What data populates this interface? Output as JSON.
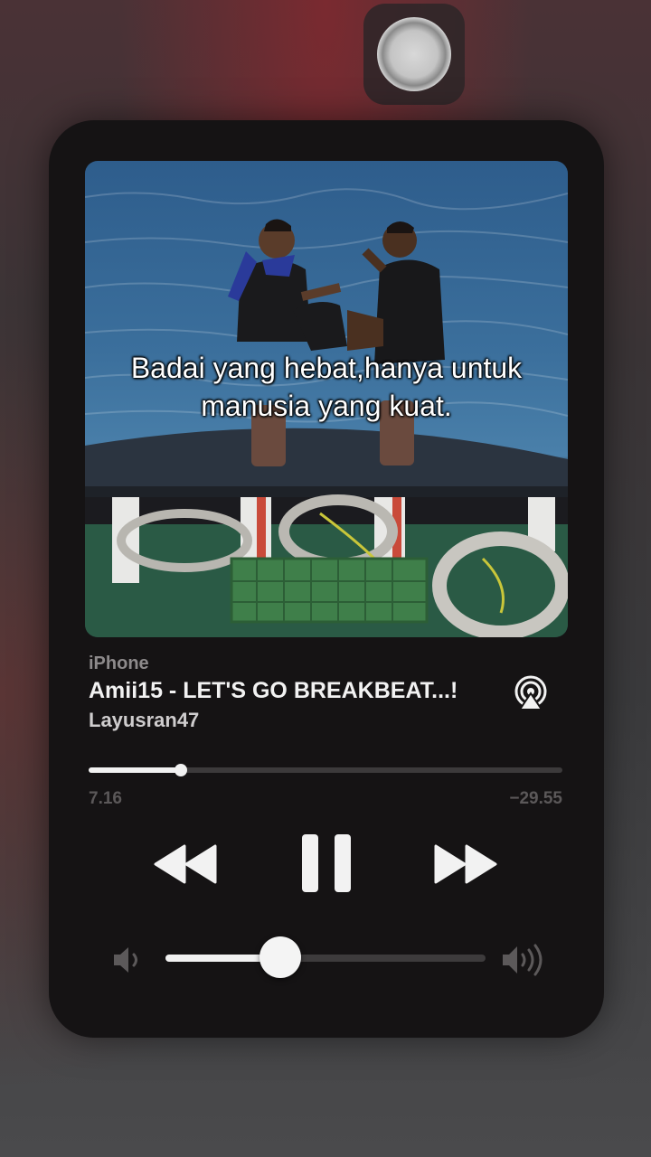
{
  "artwork": {
    "caption_line1": "Badai yang hebat,hanya untuk",
    "caption_line2": "manusia yang kuat."
  },
  "now_playing": {
    "source": "iPhone",
    "title": "Amii15 - LET'S GO BREAKBEAT...!",
    "artist": "Layusran47",
    "elapsed": "7.16",
    "remaining": "−29.55",
    "progress_fraction": 0.195
  },
  "volume": {
    "level_fraction": 0.36
  },
  "icons": {
    "airplay": "airplay-icon",
    "rewind": "rewind-icon",
    "pause": "pause-icon",
    "forward": "fast-forward-icon",
    "volume_low": "speaker-low-icon",
    "volume_high": "speaker-high-icon"
  },
  "colors": {
    "card_bg": "#151314",
    "accent": "#f1f1f1",
    "muted": "#5b5859"
  }
}
